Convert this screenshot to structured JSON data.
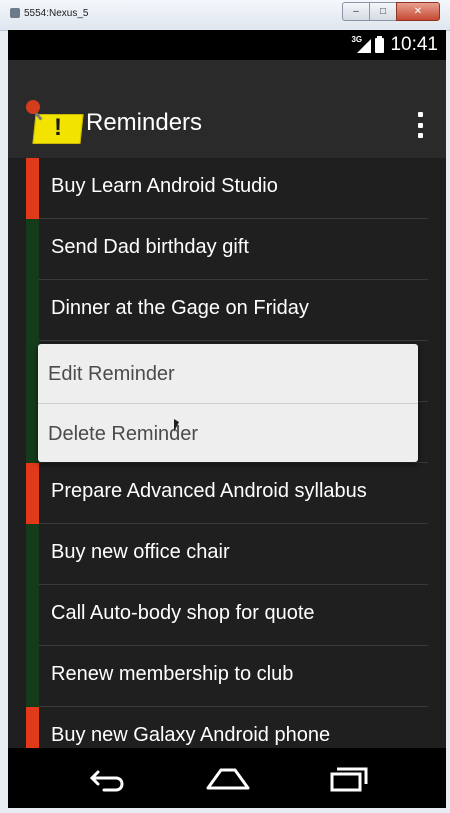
{
  "window": {
    "title": "5554:Nexus_5",
    "minimize_icon": "minimize-icon",
    "maximize_icon": "maximize-icon",
    "close_icon": "close-icon"
  },
  "status_bar": {
    "network": "3G",
    "time": "10:41",
    "icons": [
      "signal-icon",
      "battery-icon"
    ]
  },
  "action_bar": {
    "title": "Reminders",
    "app_icon": "sticky-note-pin-icon",
    "overflow_icon": "more-vert-icon"
  },
  "reminders": [
    {
      "text": "Buy Learn Android Studio",
      "important": true
    },
    {
      "text": "Send Dad birthday gift",
      "important": false
    },
    {
      "text": "Dinner at the Gage on Friday",
      "important": false
    },
    {
      "text": "",
      "important": false
    },
    {
      "text": "",
      "important": false
    },
    {
      "text": "Prepare Advanced Android syllabus",
      "important": true
    },
    {
      "text": "Buy new office chair",
      "important": false
    },
    {
      "text": "Call Auto-body shop for quote",
      "important": false
    },
    {
      "text": "Renew membership to club",
      "important": false
    },
    {
      "text": "Buy new Galaxy Android phone",
      "important": true
    }
  ],
  "context_menu": {
    "items": [
      {
        "label": "Edit Reminder"
      },
      {
        "label": "Delete Reminder"
      }
    ]
  },
  "nav_bar": {
    "icons": [
      "back-icon",
      "home-icon",
      "recent-apps-icon"
    ]
  },
  "colors": {
    "important": "#e03a1b",
    "normal": "#143c1b",
    "screen_bg": "#1f1f1f",
    "menu_bg": "#eeeeee"
  }
}
